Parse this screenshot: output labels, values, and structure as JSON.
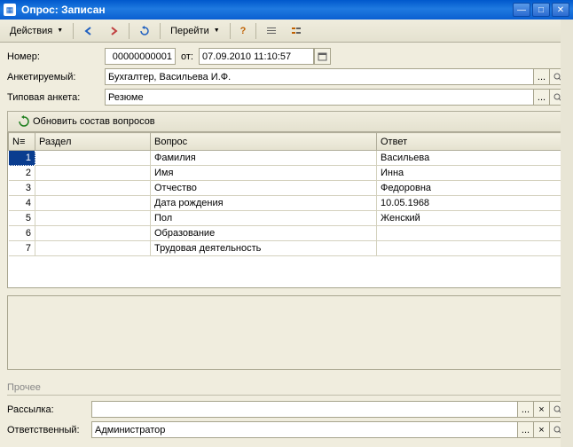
{
  "window": {
    "title": "Опрос: Записан"
  },
  "toolbar": {
    "actions": "Действия",
    "goto": "Перейти",
    "help": "?"
  },
  "fields": {
    "number_label": "Номер:",
    "number_value": "00000000001",
    "from_label": "от:",
    "date_value": "07.09.2010 11:10:57",
    "interviewee_label": "Анкетируемый:",
    "interviewee_value": "Бухгалтер, Васильева И.Ф.",
    "template_label": "Типовая анкета:",
    "template_value": "Резюме"
  },
  "table_toolbar": {
    "refresh": "Обновить состав вопросов"
  },
  "grid": {
    "headers": {
      "n": "N≡",
      "razdel": "Раздел",
      "vopros": "Вопрос",
      "otvet": "Ответ"
    },
    "rows": [
      {
        "n": "1",
        "razdel": "",
        "vopros": "Фамилия",
        "otvet": "Васильева"
      },
      {
        "n": "2",
        "razdel": "",
        "vopros": "Имя",
        "otvet": "Инна"
      },
      {
        "n": "3",
        "razdel": "",
        "vopros": "Отчество",
        "otvet": "Федоровна"
      },
      {
        "n": "4",
        "razdel": "",
        "vopros": "Дата рождения",
        "otvet": "10.05.1968"
      },
      {
        "n": "5",
        "razdel": "",
        "vopros": "Пол",
        "otvet": "Женский"
      },
      {
        "n": "6",
        "razdel": "",
        "vopros": "Образование",
        "otvet": ""
      },
      {
        "n": "7",
        "razdel": "",
        "vopros": "Трудовая деятельность",
        "otvet": ""
      }
    ]
  },
  "other": {
    "section": "Прочее",
    "mailing_label": "Рассылка:",
    "mailing_value": "",
    "responsible_label": "Ответственный:",
    "responsible_value": "Администратор"
  }
}
